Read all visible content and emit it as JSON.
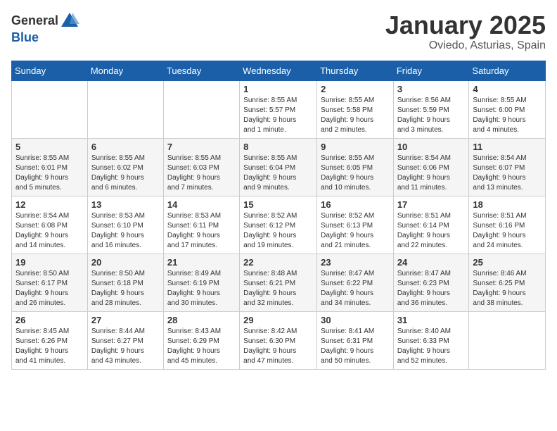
{
  "logo": {
    "general": "General",
    "blue": "Blue"
  },
  "title": "January 2025",
  "location": "Oviedo, Asturias, Spain",
  "weekdays": [
    "Sunday",
    "Monday",
    "Tuesday",
    "Wednesday",
    "Thursday",
    "Friday",
    "Saturday"
  ],
  "weeks": [
    [
      {
        "day": "",
        "info": ""
      },
      {
        "day": "",
        "info": ""
      },
      {
        "day": "",
        "info": ""
      },
      {
        "day": "1",
        "info": "Sunrise: 8:55 AM\nSunset: 5:57 PM\nDaylight: 9 hours\nand 1 minute."
      },
      {
        "day": "2",
        "info": "Sunrise: 8:55 AM\nSunset: 5:58 PM\nDaylight: 9 hours\nand 2 minutes."
      },
      {
        "day": "3",
        "info": "Sunrise: 8:56 AM\nSunset: 5:59 PM\nDaylight: 9 hours\nand 3 minutes."
      },
      {
        "day": "4",
        "info": "Sunrise: 8:55 AM\nSunset: 6:00 PM\nDaylight: 9 hours\nand 4 minutes."
      }
    ],
    [
      {
        "day": "5",
        "info": "Sunrise: 8:55 AM\nSunset: 6:01 PM\nDaylight: 9 hours\nand 5 minutes."
      },
      {
        "day": "6",
        "info": "Sunrise: 8:55 AM\nSunset: 6:02 PM\nDaylight: 9 hours\nand 6 minutes."
      },
      {
        "day": "7",
        "info": "Sunrise: 8:55 AM\nSunset: 6:03 PM\nDaylight: 9 hours\nand 7 minutes."
      },
      {
        "day": "8",
        "info": "Sunrise: 8:55 AM\nSunset: 6:04 PM\nDaylight: 9 hours\nand 9 minutes."
      },
      {
        "day": "9",
        "info": "Sunrise: 8:55 AM\nSunset: 6:05 PM\nDaylight: 9 hours\nand 10 minutes."
      },
      {
        "day": "10",
        "info": "Sunrise: 8:54 AM\nSunset: 6:06 PM\nDaylight: 9 hours\nand 11 minutes."
      },
      {
        "day": "11",
        "info": "Sunrise: 8:54 AM\nSunset: 6:07 PM\nDaylight: 9 hours\nand 13 minutes."
      }
    ],
    [
      {
        "day": "12",
        "info": "Sunrise: 8:54 AM\nSunset: 6:08 PM\nDaylight: 9 hours\nand 14 minutes."
      },
      {
        "day": "13",
        "info": "Sunrise: 8:53 AM\nSunset: 6:10 PM\nDaylight: 9 hours\nand 16 minutes."
      },
      {
        "day": "14",
        "info": "Sunrise: 8:53 AM\nSunset: 6:11 PM\nDaylight: 9 hours\nand 17 minutes."
      },
      {
        "day": "15",
        "info": "Sunrise: 8:52 AM\nSunset: 6:12 PM\nDaylight: 9 hours\nand 19 minutes."
      },
      {
        "day": "16",
        "info": "Sunrise: 8:52 AM\nSunset: 6:13 PM\nDaylight: 9 hours\nand 21 minutes."
      },
      {
        "day": "17",
        "info": "Sunrise: 8:51 AM\nSunset: 6:14 PM\nDaylight: 9 hours\nand 22 minutes."
      },
      {
        "day": "18",
        "info": "Sunrise: 8:51 AM\nSunset: 6:16 PM\nDaylight: 9 hours\nand 24 minutes."
      }
    ],
    [
      {
        "day": "19",
        "info": "Sunrise: 8:50 AM\nSunset: 6:17 PM\nDaylight: 9 hours\nand 26 minutes."
      },
      {
        "day": "20",
        "info": "Sunrise: 8:50 AM\nSunset: 6:18 PM\nDaylight: 9 hours\nand 28 minutes."
      },
      {
        "day": "21",
        "info": "Sunrise: 8:49 AM\nSunset: 6:19 PM\nDaylight: 9 hours\nand 30 minutes."
      },
      {
        "day": "22",
        "info": "Sunrise: 8:48 AM\nSunset: 6:21 PM\nDaylight: 9 hours\nand 32 minutes."
      },
      {
        "day": "23",
        "info": "Sunrise: 8:47 AM\nSunset: 6:22 PM\nDaylight: 9 hours\nand 34 minutes."
      },
      {
        "day": "24",
        "info": "Sunrise: 8:47 AM\nSunset: 6:23 PM\nDaylight: 9 hours\nand 36 minutes."
      },
      {
        "day": "25",
        "info": "Sunrise: 8:46 AM\nSunset: 6:25 PM\nDaylight: 9 hours\nand 38 minutes."
      }
    ],
    [
      {
        "day": "26",
        "info": "Sunrise: 8:45 AM\nSunset: 6:26 PM\nDaylight: 9 hours\nand 41 minutes."
      },
      {
        "day": "27",
        "info": "Sunrise: 8:44 AM\nSunset: 6:27 PM\nDaylight: 9 hours\nand 43 minutes."
      },
      {
        "day": "28",
        "info": "Sunrise: 8:43 AM\nSunset: 6:29 PM\nDaylight: 9 hours\nand 45 minutes."
      },
      {
        "day": "29",
        "info": "Sunrise: 8:42 AM\nSunset: 6:30 PM\nDaylight: 9 hours\nand 47 minutes."
      },
      {
        "day": "30",
        "info": "Sunrise: 8:41 AM\nSunset: 6:31 PM\nDaylight: 9 hours\nand 50 minutes."
      },
      {
        "day": "31",
        "info": "Sunrise: 8:40 AM\nSunset: 6:33 PM\nDaylight: 9 hours\nand 52 minutes."
      },
      {
        "day": "",
        "info": ""
      }
    ]
  ]
}
